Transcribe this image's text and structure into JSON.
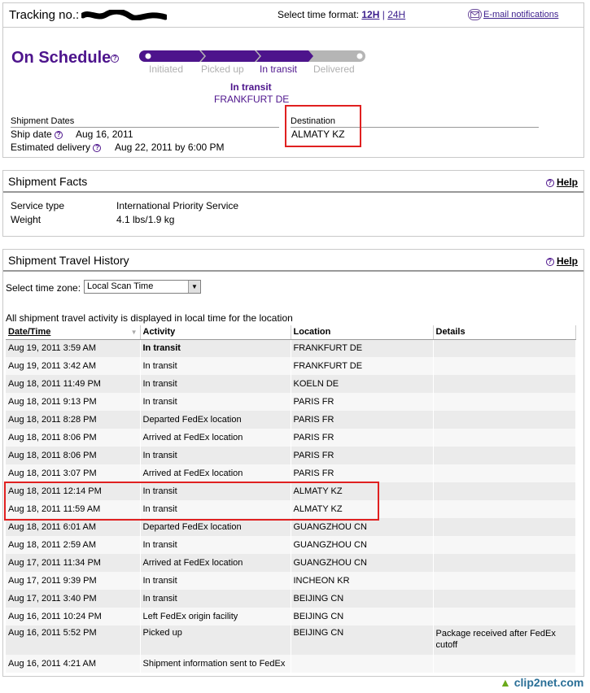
{
  "tracking": {
    "label": "Tracking no.:",
    "time_format_label": "Select time format:",
    "time_12h": "12H",
    "time_24h": "24H",
    "time_sep": "|",
    "email_link": "E-mail notifications",
    "status": "On Schedule",
    "steps": [
      "Initiated",
      "Picked up",
      "In transit",
      "Delivered"
    ],
    "current_step": "In transit",
    "current_status": "In transit",
    "current_location": "FRANKFURT DE",
    "dates_header": "Shipment Dates",
    "ship_date_label": "Ship date",
    "ship_date_value": "Aug 16, 2011",
    "est_delivery_label": "Estimated delivery",
    "est_delivery_value": "Aug 22, 2011 by 6:00 PM",
    "destination_header": "Destination",
    "destination_value": "ALMATY KZ"
  },
  "facts": {
    "title": "Shipment Facts",
    "help": "Help",
    "service_label": "Service type",
    "service_value": "International Priority Service",
    "weight_label": "Weight",
    "weight_value": "4.1 lbs/1.9 kg"
  },
  "history": {
    "title": "Shipment Travel History",
    "help": "Help",
    "timezone_label": "Select time zone:",
    "timezone_value": "Local Scan Time",
    "note": "All shipment travel activity is displayed in local time for the location",
    "columns": [
      "Date/Time",
      "Activity",
      "Location",
      "Details"
    ],
    "rows": [
      {
        "date": "Aug 19, 2011 3:59 AM",
        "activity": "In transit",
        "location": "FRANKFURT DE",
        "details": ""
      },
      {
        "date": "Aug 19, 2011 3:42 AM",
        "activity": "In transit",
        "location": "FRANKFURT DE",
        "details": ""
      },
      {
        "date": "Aug 18, 2011 11:49 PM",
        "activity": "In transit",
        "location": "KOELN DE",
        "details": ""
      },
      {
        "date": "Aug 18, 2011 9:13 PM",
        "activity": "In transit",
        "location": "PARIS FR",
        "details": ""
      },
      {
        "date": "Aug 18, 2011 8:28 PM",
        "activity": "Departed FedEx location",
        "location": "PARIS FR",
        "details": ""
      },
      {
        "date": "Aug 18, 2011 8:06 PM",
        "activity": "Arrived at FedEx location",
        "location": "PARIS FR",
        "details": ""
      },
      {
        "date": "Aug 18, 2011 8:06 PM",
        "activity": "In transit",
        "location": "PARIS FR",
        "details": ""
      },
      {
        "date": "Aug 18, 2011 3:07 PM",
        "activity": "Arrived at FedEx location",
        "location": "PARIS FR",
        "details": ""
      },
      {
        "date": "Aug 18, 2011 12:14 PM",
        "activity": "In transit",
        "location": "ALMATY KZ",
        "details": ""
      },
      {
        "date": "Aug 18, 2011 11:59 AM",
        "activity": "In transit",
        "location": "ALMATY KZ",
        "details": ""
      },
      {
        "date": "Aug 18, 2011 6:01 AM",
        "activity": "Departed FedEx location",
        "location": "GUANGZHOU CN",
        "details": ""
      },
      {
        "date": "Aug 18, 2011 2:59 AM",
        "activity": "In transit",
        "location": "GUANGZHOU CN",
        "details": ""
      },
      {
        "date": "Aug 17, 2011 11:34 PM",
        "activity": "Arrived at FedEx location",
        "location": "GUANGZHOU CN",
        "details": ""
      },
      {
        "date": "Aug 17, 2011 9:39 PM",
        "activity": "In transit",
        "location": "INCHEON KR",
        "details": ""
      },
      {
        "date": "Aug 17, 2011 3:40 PM",
        "activity": "In transit",
        "location": "BEIJING CN",
        "details": ""
      },
      {
        "date": "Aug 16, 2011 10:24 PM",
        "activity": "Left FedEx origin facility",
        "location": "BEIJING CN",
        "details": ""
      },
      {
        "date": "Aug 16, 2011 5:52 PM",
        "activity": "Picked up",
        "location": "BEIJING CN",
        "details": "Package received after FedEx cutoff"
      },
      {
        "date": "Aug 16, 2011 4:21 AM",
        "activity": "Shipment information sent to FedEx",
        "location": "",
        "details": ""
      }
    ]
  },
  "watermark": "clip2net.com",
  "colors": {
    "brand_purple": "#4d148c",
    "highlight_red": "#e02020",
    "progress_gray": "#b5b5b5"
  }
}
